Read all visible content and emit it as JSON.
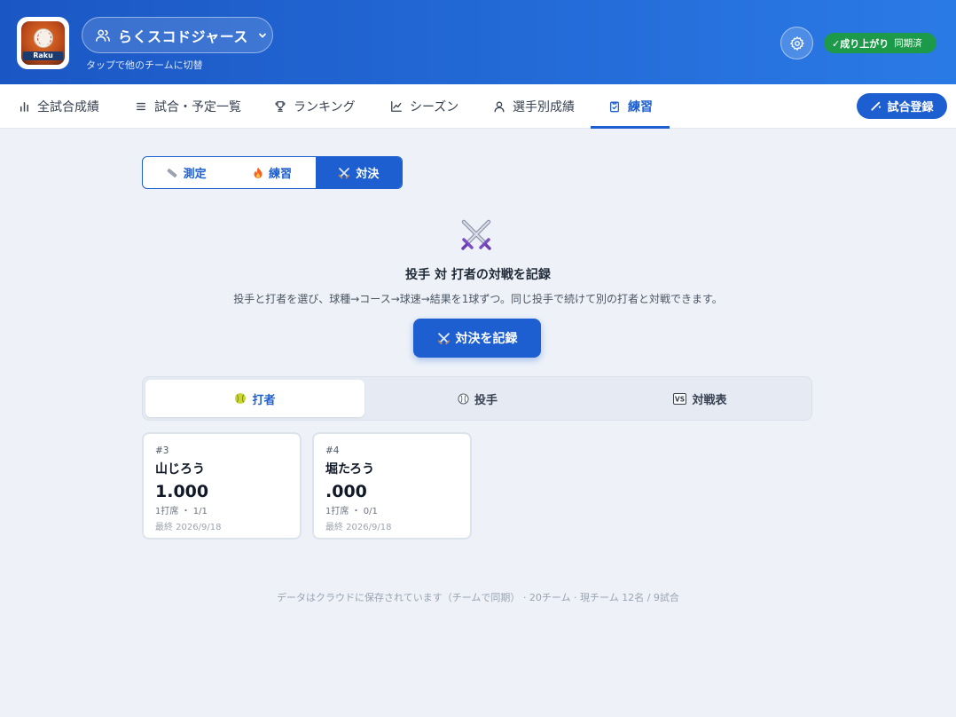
{
  "header": {
    "logo_text": "Raku",
    "team_name": "らくスコドジャース",
    "team_hint": "タップで他のチームに切替",
    "sync_status": "✓成り上がり",
    "sync_sub": "同期済",
    "colors": {
      "header_start": "#1b57c4",
      "header_end": "#2a7ae6",
      "sync_green": "#1c9a4a"
    }
  },
  "nav": {
    "items": [
      {
        "label": "全試合成績",
        "icon": "bar-chart-icon"
      },
      {
        "label": "試合・予定一覧",
        "icon": "list-icon"
      },
      {
        "label": "ランキング",
        "icon": "trophy-icon"
      },
      {
        "label": "シーズン",
        "icon": "line-chart-icon"
      },
      {
        "label": "選手別成績",
        "icon": "user-icon"
      },
      {
        "label": "練習",
        "icon": "clipboard-icon",
        "active": true
      }
    ],
    "register_label": "試合登録",
    "accent": "#1d5fd1"
  },
  "segments": [
    {
      "label": "測定",
      "icon": "ruler-icon"
    },
    {
      "label": "練習",
      "icon": "fire-icon"
    },
    {
      "label": "対決",
      "icon": "crossed-swords-icon",
      "active": true
    }
  ],
  "duel": {
    "title": "投手 対 打者の対戦を記録",
    "description": "投手と打者を選び、球種→コース→球速→結果を1球ずつ。同じ投手で続けて別の打者と対戦できます。",
    "record_button": "対決を記録"
  },
  "tabs": [
    {
      "label": "打者",
      "icon": "softball-icon",
      "active": true
    },
    {
      "label": "投手",
      "icon": "baseball-icon"
    },
    {
      "label": "対戦表",
      "icon": "vs-icon"
    }
  ],
  "players": [
    {
      "number": "#3",
      "name": "山じろう",
      "avg": "1.000",
      "stats": "1打席 ・ 1/1",
      "last": "最終 2026/9/18"
    },
    {
      "number": "#4",
      "name": "堀たろう",
      "avg": ".000",
      "stats": "1打席 ・ 0/1",
      "last": "最終 2026/9/18"
    }
  ],
  "footer": "データはクラウドに保存されています（チームで同期） · 20チーム · 現チーム 12名 / 9試合"
}
